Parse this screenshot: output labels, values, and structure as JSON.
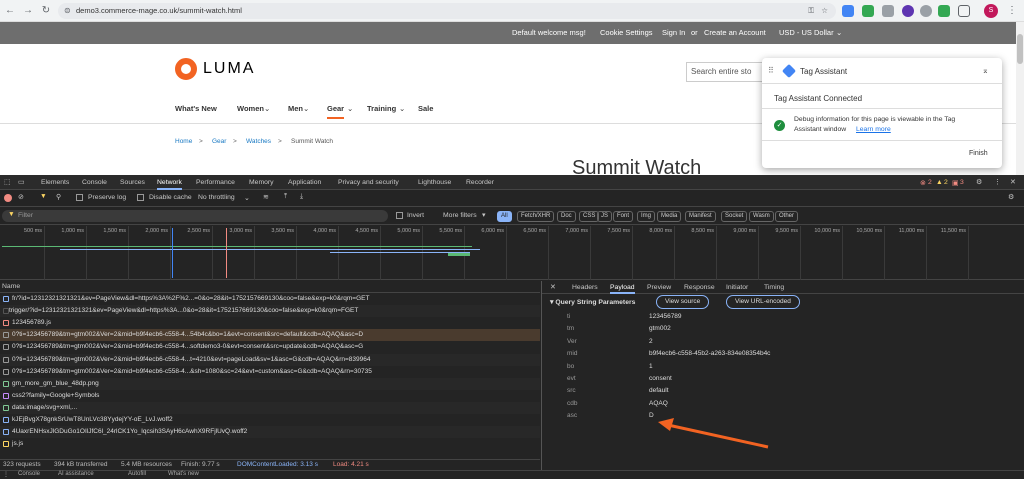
{
  "browser": {
    "url": "demo3.commerce-mage.co.uk/summit-watch.html",
    "profile_initial": "S"
  },
  "site": {
    "topbar": {
      "welcome": "Default welcome msg!",
      "cookie": "Cookie Settings",
      "signin": "Sign In",
      "or": "or",
      "create": "Create an Account",
      "currency": "USD - US Dollar"
    },
    "logo_text": "LUMA",
    "search_placeholder": "Search entire sto",
    "menu": [
      "What's New",
      "Women",
      "Men",
      "Gear",
      "Training",
      "Sale"
    ],
    "breadcrumbs": [
      "Home",
      ">",
      "Gear",
      ">",
      "Watches",
      ">",
      "Summit Watch"
    ],
    "page_title": "Summit Watch"
  },
  "tag_assistant": {
    "title": "Tag Assistant",
    "connected": "Tag Assistant Connected",
    "debug_text_1": "Debug information for this page is viewable in the Tag",
    "debug_text_2": "Assistant window",
    "learn_more": "Learn more",
    "finish": "Finish"
  },
  "devtools": {
    "tabs": [
      "Elements",
      "Console",
      "Sources",
      "Network",
      "Performance",
      "Memory",
      "Application",
      "Privacy and security",
      "Lighthouse",
      "Recorder"
    ],
    "active_tab": "Network",
    "errors": "2",
    "warnings": "2",
    "issues": "3",
    "toolbar": {
      "preserve_log": "Preserve log",
      "disable_cache": "Disable cache",
      "throttling": "No throttling"
    },
    "filter_placeholder": "Filter",
    "invert": "Invert",
    "more_filters": "More filters",
    "type_filters": [
      "All",
      "Fetch/XHR",
      "Doc",
      "CSS",
      "JS",
      "Font",
      "Img",
      "Media",
      "Manifest",
      "Socket",
      "Wasm",
      "Other"
    ],
    "timeline_ticks": [
      "500 ms",
      "1,000 ms",
      "1,500 ms",
      "2,000 ms",
      "2,500 ms",
      "3,000 ms",
      "3,500 ms",
      "4,000 ms",
      "4,500 ms",
      "5,000 ms",
      "5,500 ms",
      "6,000 ms",
      "6,500 ms",
      "7,000 ms",
      "7,500 ms",
      "8,000 ms",
      "8,500 ms",
      "9,000 ms",
      "9,500 ms",
      "10,000 ms",
      "10,500 ms",
      "11,000 ms",
      "11,500 ms"
    ],
    "name_header": "Name",
    "requests": [
      "fr/?id=12312321321321&ev=PageView&dl=https%3A%2F%2...=0&o=28&it=1752157669130&coo=false&exp=k0&rqm=GET",
      "trigger/?id=12312321321321&ev=PageView&dl=https%3A...0&o=28&it=1752157669130&coo=false&exp=k0&rqm=FGET",
      "123456789.js",
      "0?ti=123456789&tm=gtm002&Ver=2&mid=b9f4ecb6-c558-4...54b4c&bo=1&evt=consent&src=default&cdb=AQAQ&asc=D",
      "0?ti=123456789&tm=gtm002&Ver=2&mid=b9f4ecb6-c558-4...softdemo3-0&evt=consent&src=update&cdb=AQAQ&asc=G",
      "0?ti=123456789&tm=gtm002&Ver=2&mid=b9f4ecb6-c558-4...t=4210&evt=pageLoad&sv=1&asc=G&cdb=AQAQ&rn=839964",
      "0?ti=123456789&tm=gtm002&Ver=2&mid=b9f4ecb6-c558-4...&sh=1080&sc=24&evt=custom&asc=G&cdb=AQAQ&rn=30735",
      "gm_more_gm_blue_48dp.png",
      "css2?family=Google+Symbols",
      "data:image/svg+xml,...",
      "kJEjBvgX78gnkSrUwT8UnLVc38YydejYY-oE_LvJ.woff2",
      "4UaxrENHsxJlGDuGo1OIlJfC6l_24rlCK1Yo_Iqcsih3SAyH6cAwhX9RFjlUvQ.woff2",
      "js.js"
    ],
    "selected_request_index": 3,
    "status_bar": {
      "requests": "323 requests",
      "transferred": "394 kB transferred",
      "resources": "5.4 MB resources",
      "finish": "Finish: 9.77 s",
      "dcl": "DOMContentLoaded: 3.13 s",
      "load": "Load: 4.21 s"
    },
    "detail_tabs": [
      "Headers",
      "Payload",
      "Preview",
      "Response",
      "Initiator",
      "Timing"
    ],
    "active_detail_tab": "Payload",
    "qsp_title": "Query String Parameters",
    "view_source": "View source",
    "view_url_encoded": "View URL-encoded",
    "params": [
      {
        "k": "ti",
        "v": "123456789"
      },
      {
        "k": "tm",
        "v": "gtm002"
      },
      {
        "k": "Ver",
        "v": "2"
      },
      {
        "k": "mid",
        "v": "b9f4ecb6-c558-45b2-a263-834e08354b4c"
      },
      {
        "k": "bo",
        "v": "1"
      },
      {
        "k": "evt",
        "v": "consent"
      },
      {
        "k": "src",
        "v": "default"
      },
      {
        "k": "cdb",
        "v": "AQAQ"
      },
      {
        "k": "asc",
        "v": "D"
      }
    ],
    "drawer_tabs": [
      "Console",
      "AI assistance",
      "Autofill",
      "What's new"
    ],
    "colors": {
      "accent": "#f26322",
      "selected_row": "#4a3b2e",
      "link": "#8ab4f8"
    }
  }
}
